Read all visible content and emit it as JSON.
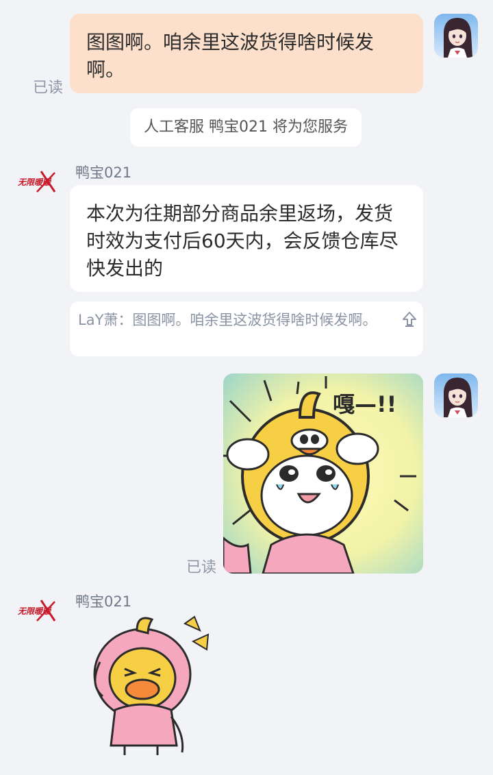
{
  "messages": {
    "user_message_1": {
      "text": "图图啊。咱余里这波货得啥时候发啊。",
      "read_status": "已读"
    },
    "system_notice": "人工客服 鸭宝021 将为您服务",
    "agent_message_1": {
      "sender": "鸭宝021",
      "text": "本次为往期部分商品余里返场，发货时效为支付后60天内，会反馈仓库尽快发出的",
      "quote": "LaY萧：图图啊。咱余里这波货得啥时候发啊。"
    },
    "user_message_2": {
      "type": "sticker",
      "sticker_caption": "嘎—!!",
      "read_status": "已读"
    },
    "agent_message_2": {
      "sender": "鸭宝021",
      "type": "sticker"
    }
  },
  "agent_logo_text": "无限暖暖",
  "colors": {
    "background": "#f2f3f6",
    "user_bubble": "#fde0cc",
    "agent_bubble": "#ffffff",
    "meta_text": "#8e97a8"
  }
}
